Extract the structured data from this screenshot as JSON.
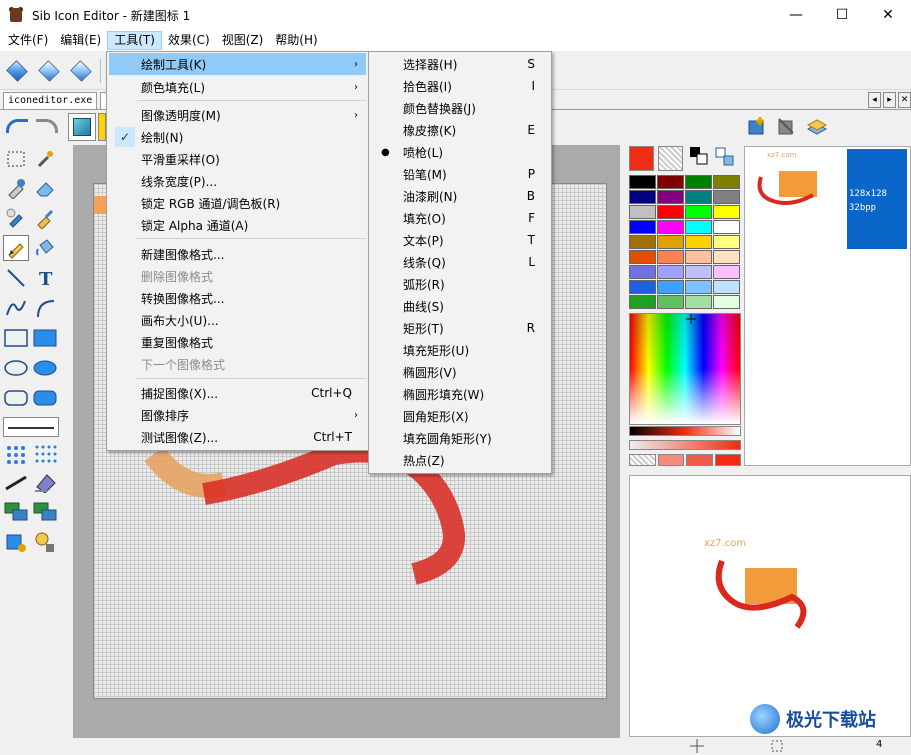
{
  "window": {
    "title": "Sib Icon Editor - 新建图标 1",
    "minimize": "—",
    "maximize": "☐",
    "close": "✕"
  },
  "menubar": [
    "文件(F)",
    "编辑(E)",
    "工具(T)",
    "效果(C)",
    "视图(Z)",
    "帮助(H)"
  ],
  "doc_tab": "iconeditor.exe",
  "tools_menu": [
    {
      "label": "绘制工具(K)",
      "arrow": "›",
      "highlighted": true
    },
    {
      "label": "颜色填充(L)",
      "arrow": "›"
    },
    {
      "label": "图像透明度(M)",
      "arrow": "›"
    },
    {
      "label": "绘制(N)",
      "checked": true,
      "check": "✓"
    },
    {
      "label": "平滑重采样(O)"
    },
    {
      "label": "线条宽度(P)..."
    },
    {
      "label": "锁定 RGB 通道/调色板(R)"
    },
    {
      "label": "锁定 Alpha 通道(A)"
    },
    {
      "label": "新建图像格式..."
    },
    {
      "label": "删除图像格式",
      "disabled": true
    },
    {
      "label": "转换图像格式..."
    },
    {
      "label": "画布大小(U)..."
    },
    {
      "label": "重复图像格式"
    },
    {
      "label": "下一个图像格式",
      "disabled": true
    },
    {
      "label": "捕捉图像(X)...",
      "shortcut": "Ctrl+Q"
    },
    {
      "label": "图像排序",
      "arrow": "›"
    },
    {
      "label": "测试图像(Z)...",
      "shortcut": "Ctrl+T"
    }
  ],
  "draw_tools_menu": [
    {
      "label": "选择器(H)",
      "shortcut": "S"
    },
    {
      "label": "拾色器(I)",
      "shortcut": "I"
    },
    {
      "label": "颜色替换器(J)",
      "shortcut": ""
    },
    {
      "label": "橡皮擦(K)",
      "shortcut": "E"
    },
    {
      "label": "喷枪(L)",
      "shortcut": "",
      "selected": true,
      "dot": "●"
    },
    {
      "label": "铅笔(M)",
      "shortcut": "P"
    },
    {
      "label": "油漆刷(N)",
      "shortcut": "B"
    },
    {
      "label": "填充(O)",
      "shortcut": "F"
    },
    {
      "label": "文本(P)",
      "shortcut": "T"
    },
    {
      "label": "线条(Q)",
      "shortcut": "L"
    },
    {
      "label": "弧形(R)",
      "shortcut": ""
    },
    {
      "label": "曲线(S)",
      "shortcut": ""
    },
    {
      "label": "矩形(T)",
      "shortcut": "R"
    },
    {
      "label": "填充矩形(U)",
      "shortcut": ""
    },
    {
      "label": "椭圆形(V)",
      "shortcut": ""
    },
    {
      "label": "椭圆形填充(W)",
      "shortcut": ""
    },
    {
      "label": "圆角矩形(X)",
      "shortcut": ""
    },
    {
      "label": "填充圆角矩形(Y)",
      "shortcut": ""
    },
    {
      "label": "热点(Z)",
      "shortcut": ""
    }
  ],
  "palette_colors": [
    "#000000",
    "#800000",
    "#008000",
    "#808000",
    "#000080",
    "#800080",
    "#008080",
    "#808080",
    "#c0c0c0",
    "#ff0000",
    "#00ff00",
    "#ffff00",
    "#0000ff",
    "#ff00ff",
    "#00ffff",
    "#ffffff",
    "#a07000",
    "#e0a000",
    "#ffd000",
    "#ffff80",
    "#e05000",
    "#ff8050",
    "#ffc0a0",
    "#ffe0c0",
    "#7070e0",
    "#a0a0ff",
    "#c0c0ff",
    "#ffc0ff",
    "#2060e0",
    "#40a0ff",
    "#80c0ff",
    "#c0e0ff",
    "#20a020",
    "#60c060",
    "#a0e0a0",
    "#e0ffe0"
  ],
  "foreground_color": "#f02c14",
  "preview": {
    "watermark_top": "xz7.com",
    "size": "128x128",
    "depth": "32bpp",
    "watermark_bottom": "xz7.com"
  },
  "site_watermark": "极光下载站",
  "status": {
    "zoom": "4"
  }
}
